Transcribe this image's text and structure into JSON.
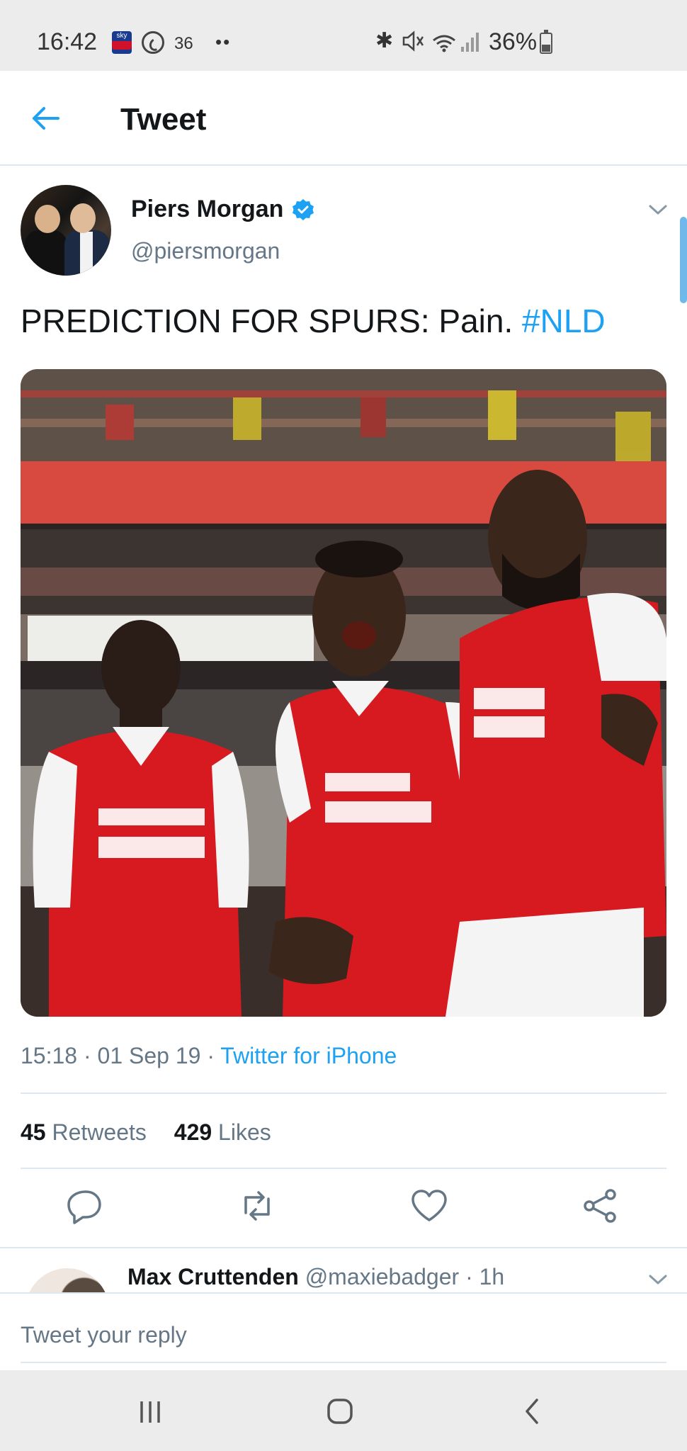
{
  "status_bar": {
    "time": "16:42",
    "notification_count": "36",
    "more_dots": "••",
    "battery": "36%",
    "icons": [
      "sky-bet-icon",
      "whatsapp-icon",
      "bluetooth-icon",
      "mute-icon",
      "wifi-icon",
      "signal-icon",
      "battery-icon"
    ]
  },
  "header": {
    "back_icon": "arrow-left-icon",
    "title": "Tweet"
  },
  "tweet": {
    "author_name": "Piers Morgan",
    "author_handle": "@piersmorgan",
    "verified": true,
    "text": "PREDICTION FOR SPURS: Pain.",
    "hashtag": "#NLD",
    "image_description_icon": "photo",
    "timestamp": "15:18 · 01 Sep 19 · ",
    "source": "Twitter for iPhone",
    "retweets_count": "45",
    "retweets_label": "Retweets",
    "likes_count": "429",
    "likes_label": "Likes"
  },
  "actions": {
    "reply_icon": "reply-icon",
    "retweet_icon": "retweet-icon",
    "like_icon": "heart-icon",
    "share_icon": "share-icon"
  },
  "reply_preview": {
    "name": "Max Cruttenden",
    "meta": "@maxiebadger · 1h"
  },
  "reply_box": {
    "placeholder": "Tweet your reply"
  },
  "nav_bar": {
    "icons": [
      "recent-apps-icon",
      "home-icon",
      "back-icon"
    ]
  },
  "colors": {
    "twitter_blue": "#1da1f2",
    "text_primary": "#14171a",
    "text_secondary": "#657786",
    "divider": "#e1e8ed",
    "arsenal_red": "#d71920"
  }
}
